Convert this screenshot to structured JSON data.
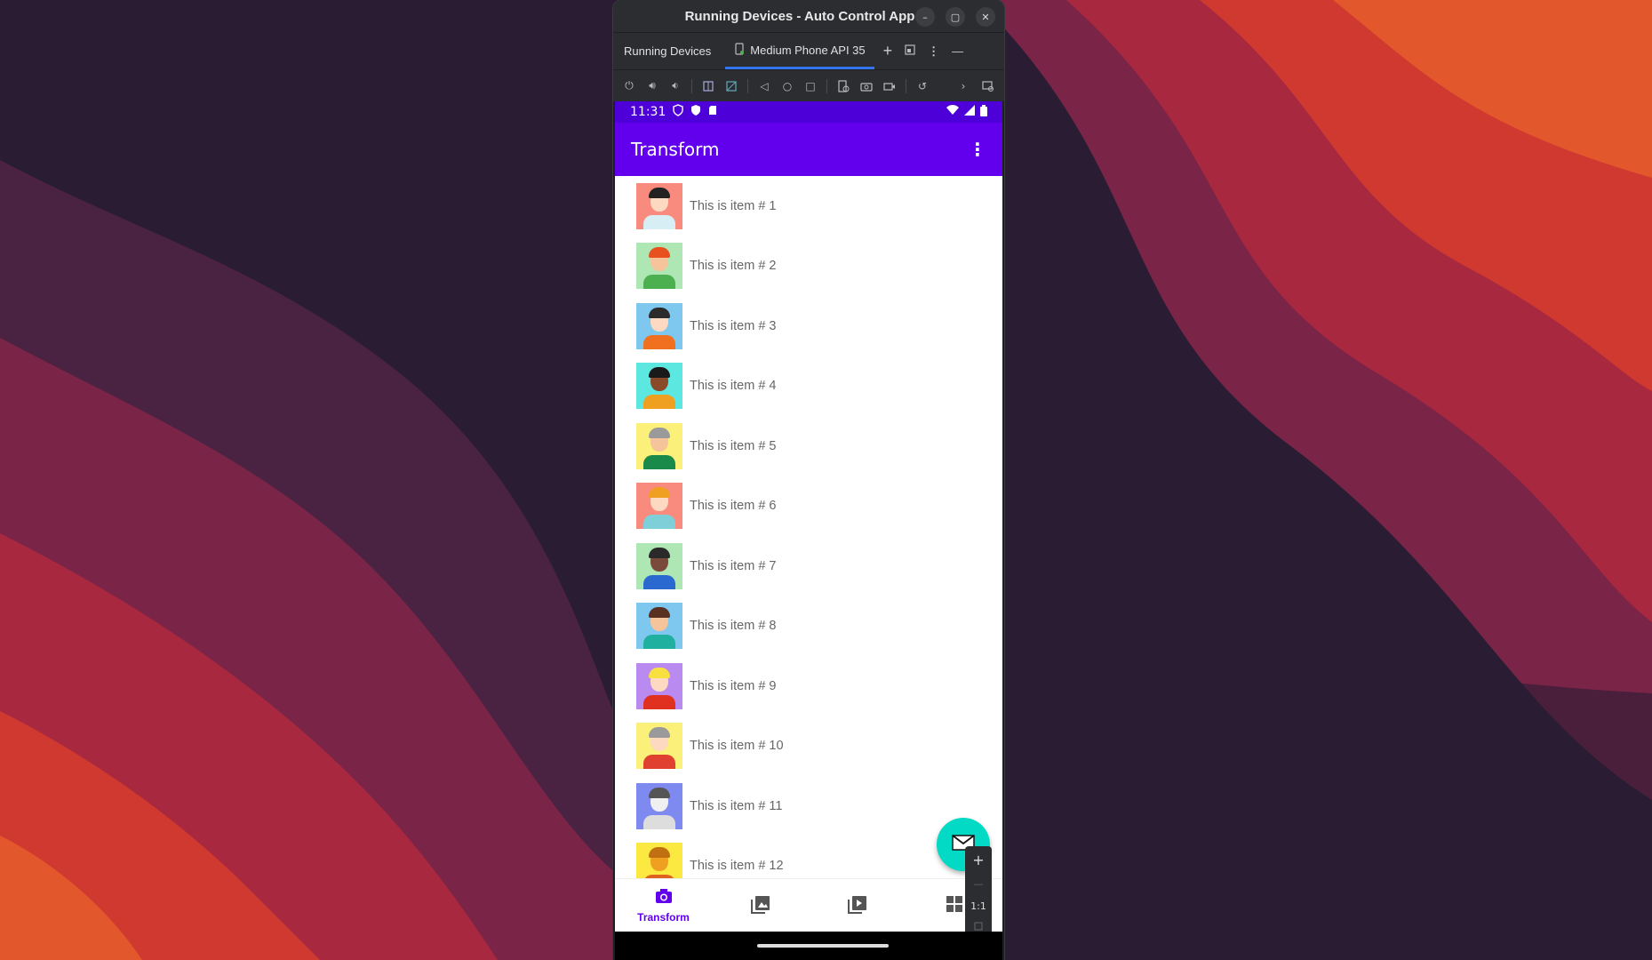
{
  "window": {
    "title": "Running Devices - Auto Control App",
    "controls": {
      "minimize": "–",
      "maximize": "▢",
      "close": "✕"
    }
  },
  "tabbar": {
    "panel_label": "Running Devices",
    "device_tab": "Medium Phone API 35",
    "add_symbol": "+"
  },
  "toolbar": {
    "icons": [
      "power-icon",
      "volume-up-icon",
      "volume-down-icon",
      "rotate-left-icon",
      "rotate-right-icon",
      "back-icon",
      "home-icon",
      "overview-icon",
      "device-snapshot-icon",
      "screenshot-icon",
      "screen-record-icon",
      "reset-icon",
      "more-icon",
      "mirror-icon"
    ]
  },
  "statusbar": {
    "time": "11:31"
  },
  "appbar": {
    "title": "Transform"
  },
  "list": {
    "items": [
      {
        "label": "This is item # 1",
        "bg": "#f88b7e",
        "skin": "#fcd9c0",
        "hair": "#222222",
        "shirt": "#d8eef5"
      },
      {
        "label": "This is item # 2",
        "bg": "#aee6b4",
        "skin": "#f5c49a",
        "hair": "#e8501f",
        "shirt": "#4caf50"
      },
      {
        "label": "This is item # 3",
        "bg": "#7ec8f0",
        "skin": "#fcd9c0",
        "hair": "#2b2b2b",
        "shirt": "#f07020"
      },
      {
        "label": "This is item # 4",
        "bg": "#5ce8e0",
        "skin": "#8a4a2a",
        "hair": "#1a1a1a",
        "shirt": "#f0a020"
      },
      {
        "label": "This is item # 5",
        "bg": "#fbf07a",
        "skin": "#f5c49a",
        "hair": "#9a9a9a",
        "shirt": "#1a8a4a"
      },
      {
        "label": "This is item # 6",
        "bg": "#f88b7e",
        "skin": "#fcd9c0",
        "hair": "#f0a020",
        "shirt": "#7ecfd8"
      },
      {
        "label": "This is item # 7",
        "bg": "#aee6b4",
        "skin": "#7a4a3a",
        "hair": "#2a2a2a",
        "shirt": "#2a6ad0"
      },
      {
        "label": "This is item # 8",
        "bg": "#7ec8f0",
        "skin": "#f5c49a",
        "hair": "#5a3020",
        "shirt": "#20b0a0"
      },
      {
        "label": "This is item # 9",
        "bg": "#b98af0",
        "skin": "#fcd9c0",
        "hair": "#f8e040",
        "shirt": "#e03020"
      },
      {
        "label": "This is item # 10",
        "bg": "#fbf07a",
        "skin": "#fcd9c0",
        "hair": "#9a9a9a",
        "shirt": "#e04030"
      },
      {
        "label": "This is item # 11",
        "bg": "#7e8af0",
        "skin": "#f0f0f0",
        "hair": "#555555",
        "shirt": "#dddddd"
      },
      {
        "label": "This is item # 12",
        "bg": "#fbe840",
        "skin": "#f0a020",
        "hair": "#c07010",
        "shirt": "#e06020"
      }
    ]
  },
  "zoom": {
    "plus": "+",
    "minus": "—",
    "ratio": "1:1"
  },
  "bottomnav": {
    "items": [
      {
        "label": "Transform",
        "active": true
      },
      {
        "label": "",
        "active": false
      },
      {
        "label": "",
        "active": false
      },
      {
        "label": "",
        "active": false
      }
    ]
  },
  "colors": {
    "primary": "#6200ee",
    "primary_dark": "#4d00d8",
    "fab": "#03dac5"
  }
}
